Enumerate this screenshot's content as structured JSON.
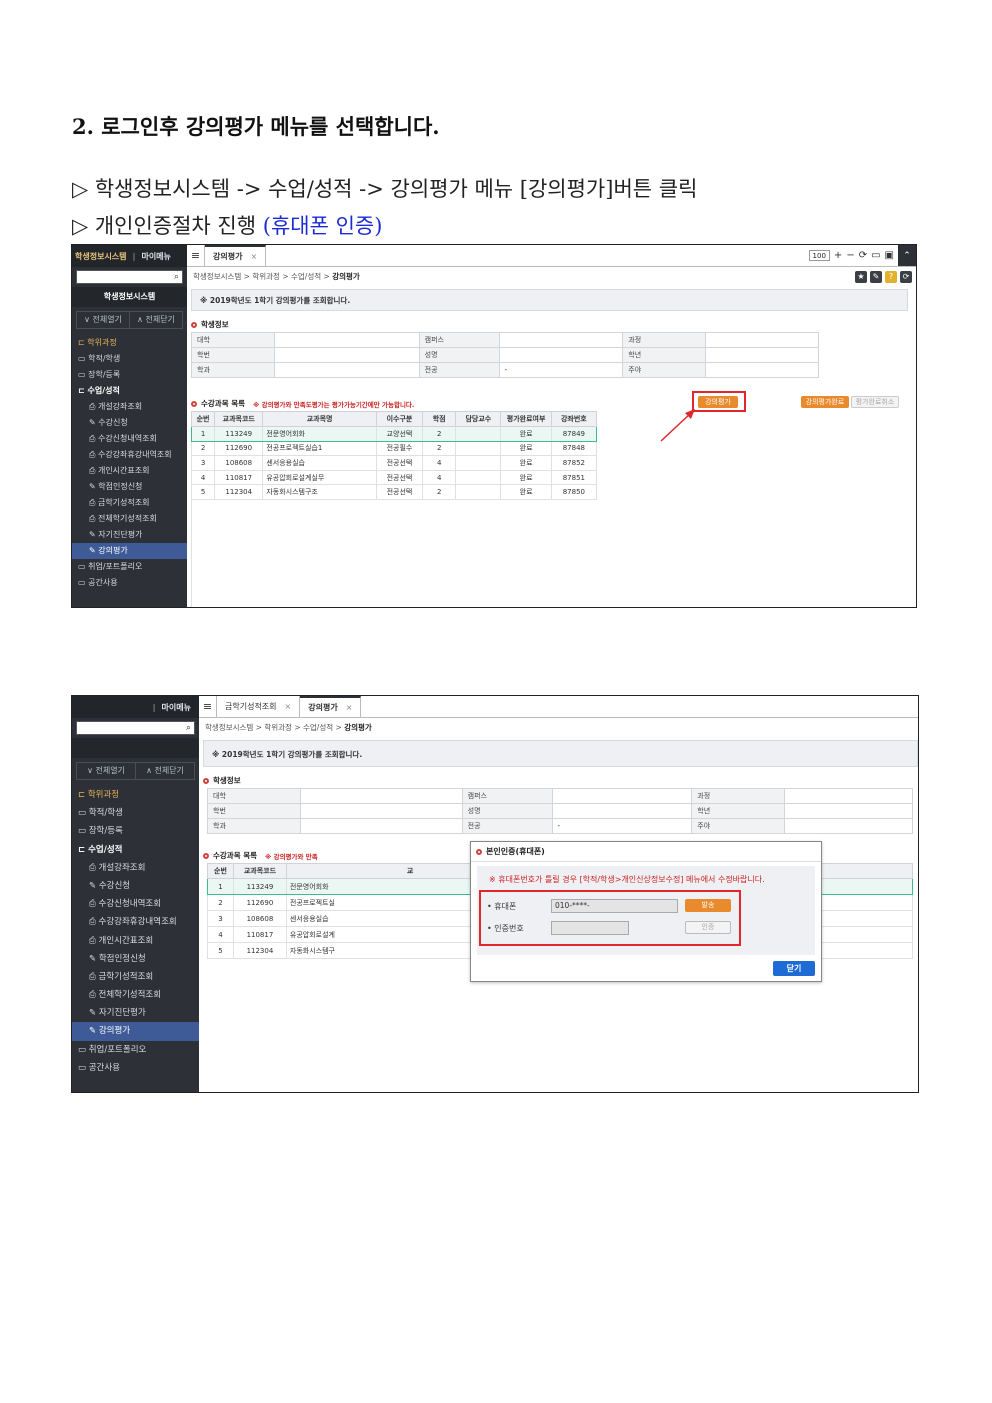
{
  "heading": "2. 로그인후 강의평가 메뉴를 선택합니다.",
  "instructions": {
    "line1": "▷ 학생정보시스템 -> 수업/성적 -> 강의평가 메뉴 [강의평가]버튼 클릭",
    "line2_prefix": "▷ 개인인증절차 진행 ",
    "line2_highlight": "(휴대폰 인증)"
  },
  "colors": {
    "accent_orange": "#e98a2c",
    "highlight_red": "#e2262b",
    "instruction_blue": "#1c2bd4",
    "sidebar_bg": "#2d3137",
    "active_menu": "#3f5b97",
    "close_button": "#1e6bd6"
  },
  "sidebar": {
    "system_label": "학생정보시스템",
    "my_menu": "마이메뉴",
    "title": "학생정보시스템",
    "expand_all": "∨ 전체열기",
    "collapse_all": "∧ 전체닫기",
    "items": [
      {
        "label": "학위과정",
        "type": "folder-open"
      },
      {
        "label": "학적/학생",
        "type": "folder"
      },
      {
        "label": "장학/등록",
        "type": "folder"
      },
      {
        "label": "수업/성적",
        "type": "folder-open-bold"
      },
      {
        "label": "개설강좌조회",
        "type": "print"
      },
      {
        "label": "수강신청",
        "type": "edit"
      },
      {
        "label": "수강신청내역조회",
        "type": "print"
      },
      {
        "label": "수강강좌휴강내역조회",
        "type": "print"
      },
      {
        "label": "개인시간표조회",
        "type": "print"
      },
      {
        "label": "학점인정신청",
        "type": "edit"
      },
      {
        "label": "금학기성적조회",
        "type": "print"
      },
      {
        "label": "전체학기성적조회",
        "type": "print"
      },
      {
        "label": "자기진단평가",
        "type": "edit"
      },
      {
        "label": "강의평가",
        "type": "edit-active"
      },
      {
        "label": "취업/포트폴리오",
        "type": "folder"
      },
      {
        "label": "공간사용",
        "type": "folder"
      }
    ]
  },
  "tabs": {
    "screen1": [
      {
        "label": "강의평가"
      }
    ],
    "screen2": [
      {
        "label": "금학기성적조회"
      },
      {
        "label": "강의평가"
      }
    ],
    "close_glyph": "×",
    "zoom": "100"
  },
  "breadcrumb": {
    "path": "학생정보시스템 > 학위과정 > 수업/성적 > ",
    "current": "강의평가"
  },
  "notice": "※ 2019학년도 1학기 강의평가를 조회합니다.",
  "student_info": {
    "section_title": "학생정보",
    "rows": [
      [
        "대학",
        "",
        "캠퍼스",
        "",
        "과정",
        ""
      ],
      [
        "학번",
        "",
        "성명",
        "",
        "학년",
        ""
      ],
      [
        "학과",
        "",
        "전공",
        "-",
        "주야",
        ""
      ]
    ]
  },
  "course_list": {
    "section_title": "수강과목 목록",
    "warning": "※ 강의평가와 만족도평가는 평가가능기간에만 가능합니다.",
    "headers": [
      "순번",
      "교과목코드",
      "교과목명",
      "이수구분",
      "학점",
      "담당교수",
      "평가완료여부",
      "강좌번호"
    ],
    "rows": [
      [
        "1",
        "113249",
        "전문영어회화",
        "교양선택",
        "2",
        "",
        "완료",
        "87849"
      ],
      [
        "2",
        "112690",
        "전공프로젝트실습1",
        "전공필수",
        "2",
        "",
        "완료",
        "87848"
      ],
      [
        "3",
        "108608",
        "센서응용실습",
        "전공선택",
        "4",
        "",
        "완료",
        "87852"
      ],
      [
        "4",
        "110817",
        "유공압회로설계실무",
        "전공선택",
        "4",
        "",
        "완료",
        "87851"
      ],
      [
        "5",
        "112304",
        "자동화시스템구조",
        "전공선택",
        "2",
        "",
        "완료",
        "87850"
      ]
    ],
    "screen2_rows": [
      [
        "1",
        "113249",
        "전문영어회화"
      ],
      [
        "2",
        "112690",
        "전공프로젝트실"
      ],
      [
        "3",
        "108608",
        "센서응용실습"
      ],
      [
        "4",
        "110817",
        "유공압회로설계"
      ],
      [
        "5",
        "112304",
        "자동화시스템구"
      ]
    ],
    "screen2_warning": "※ 강의평가와 만족",
    "screen2_header_partial": "교"
  },
  "buttons": {
    "evaluate": "강의평가",
    "satisfaction_eval": "강의평가완료",
    "cancel_eval": "평가완료취소"
  },
  "popup": {
    "title": "본인인증(휴대폰)",
    "warning": "※ 휴대폰번호가 틀릴 경우 [학적/학생>개인신상정보수정] 메뉴에서 수정바랍니다.",
    "phone_label": "• 휴대폰",
    "phone_value": "010-****-",
    "auth_label": "• 인증번호",
    "send": "발송",
    "verify": "인증",
    "close": "닫기"
  }
}
